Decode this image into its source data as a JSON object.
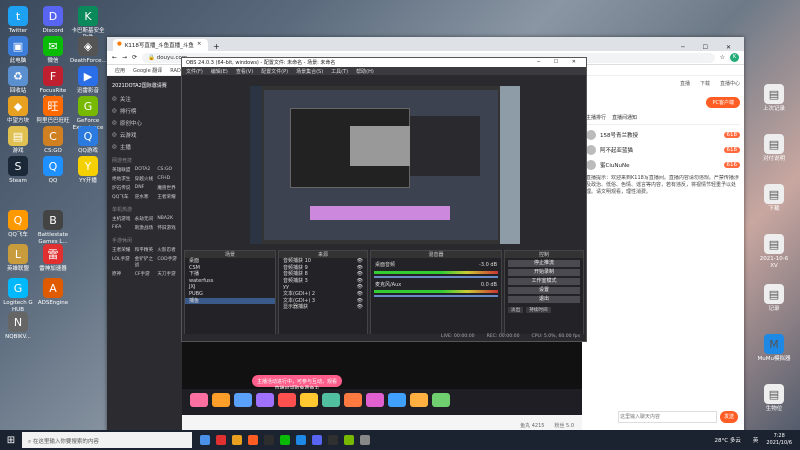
{
  "desktop": {
    "icons_left": [
      {
        "label": "Twitter",
        "color": "#1da1f2",
        "glyph": "t"
      },
      {
        "label": "Discord",
        "color": "#5865f2",
        "glyph": "D"
      },
      {
        "label": "卡巴斯基安全软件",
        "color": "#0a8a5a",
        "glyph": "K"
      },
      {
        "label": "此电脑",
        "color": "#3b7dd8",
        "glyph": "▣"
      },
      {
        "label": "微信",
        "color": "#09bb07",
        "glyph": "✉"
      },
      {
        "label": "DeathForce...",
        "color": "#555",
        "glyph": "◈"
      },
      {
        "label": "回收站",
        "color": "#5a8fd0",
        "glyph": "♻"
      },
      {
        "label": "FocusRite Control",
        "color": "#c01f2f",
        "glyph": "F"
      },
      {
        "label": "迅雷影音",
        "color": "#2a6ee8",
        "glyph": "▶"
      },
      {
        "label": "中望方块",
        "color": "#e8a020",
        "glyph": "◆"
      },
      {
        "label": "阿里巴巴旺旺",
        "color": "#ff6a00",
        "glyph": "旺"
      },
      {
        "label": "GeForce Experience",
        "color": "#76b900",
        "glyph": "G"
      },
      {
        "label": "游戏",
        "color": "#e0c050",
        "glyph": "▤"
      },
      {
        "label": "CS:GO",
        "color": "#d08020",
        "glyph": "C"
      },
      {
        "label": "QQ游戏",
        "color": "#2a7ae0",
        "glyph": "Q"
      },
      {
        "label": "Steam",
        "color": "#1b2838",
        "glyph": "S"
      },
      {
        "label": "QQ",
        "color": "#1e90ff",
        "glyph": "Q"
      },
      {
        "label": "YY开播",
        "color": "#f5d000",
        "glyph": "Y"
      },
      {
        "label": "QQ飞车",
        "color": "#ff9900",
        "glyph": "Q"
      },
      {
        "label": "Battlestate Games L...",
        "color": "#444",
        "glyph": "B"
      },
      {
        "label": "英雄联盟",
        "color": "#c89b3c",
        "glyph": "L"
      },
      {
        "label": "雷神加速器",
        "color": "#e03030",
        "glyph": "雷"
      },
      {
        "label": "Logitech G HUB",
        "color": "#00b8fc",
        "glyph": "G"
      },
      {
        "label": "ADSEngine",
        "color": "#e05a00",
        "glyph": "A"
      },
      {
        "label": "NQBIKV...",
        "color": "#666",
        "glyph": "N"
      }
    ],
    "icons_right": [
      {
        "label": "上次记录",
        "color": "#eee",
        "glyph": "▤"
      },
      {
        "label": "对付说明",
        "color": "#eee",
        "glyph": "▤"
      },
      {
        "label": "下载",
        "color": "#eee",
        "glyph": "▤"
      },
      {
        "label": "2021-10-6 XV",
        "color": "#eee",
        "glyph": "▤"
      },
      {
        "label": "记录",
        "color": "#eee",
        "glyph": "▤"
      },
      {
        "label": "MuMu模拟器",
        "color": "#1e88e5",
        "glyph": "M"
      },
      {
        "label": "生物位",
        "color": "#eee",
        "glyph": "▤"
      }
    ]
  },
  "browser": {
    "tab_title": "K118写直播_斗鱼直播_斗鱼",
    "url": "douyu.com",
    "bookmarks": [
      "应用",
      "Google 翻译",
      "RADWIMPS 官方...",
      "风风家游戏"
    ],
    "profile": "K"
  },
  "site": {
    "left_nav": [
      "关注",
      "排行榜",
      "原创中心",
      "云游戏",
      "主播"
    ],
    "sections": [
      {
        "title": "网游竞技",
        "items": [
          "英雄联盟",
          "DOTA2",
          "CS:GO",
          "绝地求生",
          "穿越火线",
          "CFHD",
          "炉石传说",
          "DNF",
          "魔兽世界",
          "QQ飞车",
          "逆水寒",
          "王者荣耀"
        ]
      },
      {
        "title": "单机热游",
        "items": [
          "主机游戏",
          "永劫无间",
          "NBA2K",
          "FIFA",
          "刺激战场",
          "怀旧游戏"
        ]
      },
      {
        "title": "手游休闲",
        "items": [
          "王者荣耀",
          "和平精英",
          "火影忍者",
          "LOL手游",
          "金铲铲之战",
          "COD手游",
          "原神",
          "CF手游",
          "天刀手游"
        ]
      }
    ],
    "channel": "2021DOTA2国际邀请赛",
    "right_header": [
      "直播",
      "下载",
      "直播中心"
    ],
    "right_tabs": [
      "主播排行",
      "直播间通知",
      "PC客户端"
    ],
    "ranking": [
      {
        "name": "158号青兰教授",
        "badge": "618"
      },
      {
        "name": "阿不起亚蓝猫",
        "badge": "618"
      },
      {
        "name": "蜜CiuNuNe",
        "badge": "616"
      }
    ],
    "notice": "直播提示：欢迎来到K118写直播间。直播内容请勿违规。严禁传播涉及政治、低俗、色情、谣言等内容，若有违反，将视情节轻重予以处理。请文明观看，理性消费。",
    "chat_placeholder": "这里输入聊天内容",
    "send": "发送",
    "gift_prompt": "主播活动进行中，可参与互动，观看直播可领取免费鱼丸",
    "balance": "鱼丸 4215",
    "fans": "粉丝 5.0"
  },
  "obs": {
    "title": "OBS 24.0.3 (64-bit, windows) - 配置文件: 未命名 - 场景: 未命名",
    "menu": [
      "文件(F)",
      "编辑(E)",
      "查看(V)",
      "配置文件(P)",
      "场景集合(S)",
      "工具(T)",
      "帮助(H)"
    ],
    "docks": {
      "scenes": "场景",
      "sources": "来源",
      "mixer": "混音器",
      "transitions": "转场",
      "controls": "控制"
    },
    "scenes": [
      "桌面",
      "CSM",
      "下播",
      "waterfuss",
      "JXJ",
      "PUBG",
      "捕鱼"
    ],
    "sources": [
      "音频捕获 10",
      "音频捕获 9",
      "音频捕获 8",
      "音频捕获 3",
      "yy",
      "文本(GDI+) 2",
      "文本(GDI+) 3",
      "显示器捕获"
    ],
    "mixer": [
      {
        "name": "桌面音频",
        "db": "-3.0 dB"
      },
      {
        "name": "麦克风/Aux",
        "db": "0.0 dB"
      }
    ],
    "controls": [
      "停止推流",
      "开始录制",
      "工作室模式",
      "设置",
      "退出"
    ],
    "transition": [
      "淡出",
      "持续时间"
    ],
    "status": [
      "LIVE: 00:00:00",
      "REC: 00:00:00",
      "CPU: 5.0%, 60.00 fps"
    ]
  },
  "taskbar": {
    "search": "在这里输入你要搜索的内容",
    "weather": "28°C 多云",
    "time": "7:28",
    "date": "2021/10/6",
    "lang": "英"
  }
}
